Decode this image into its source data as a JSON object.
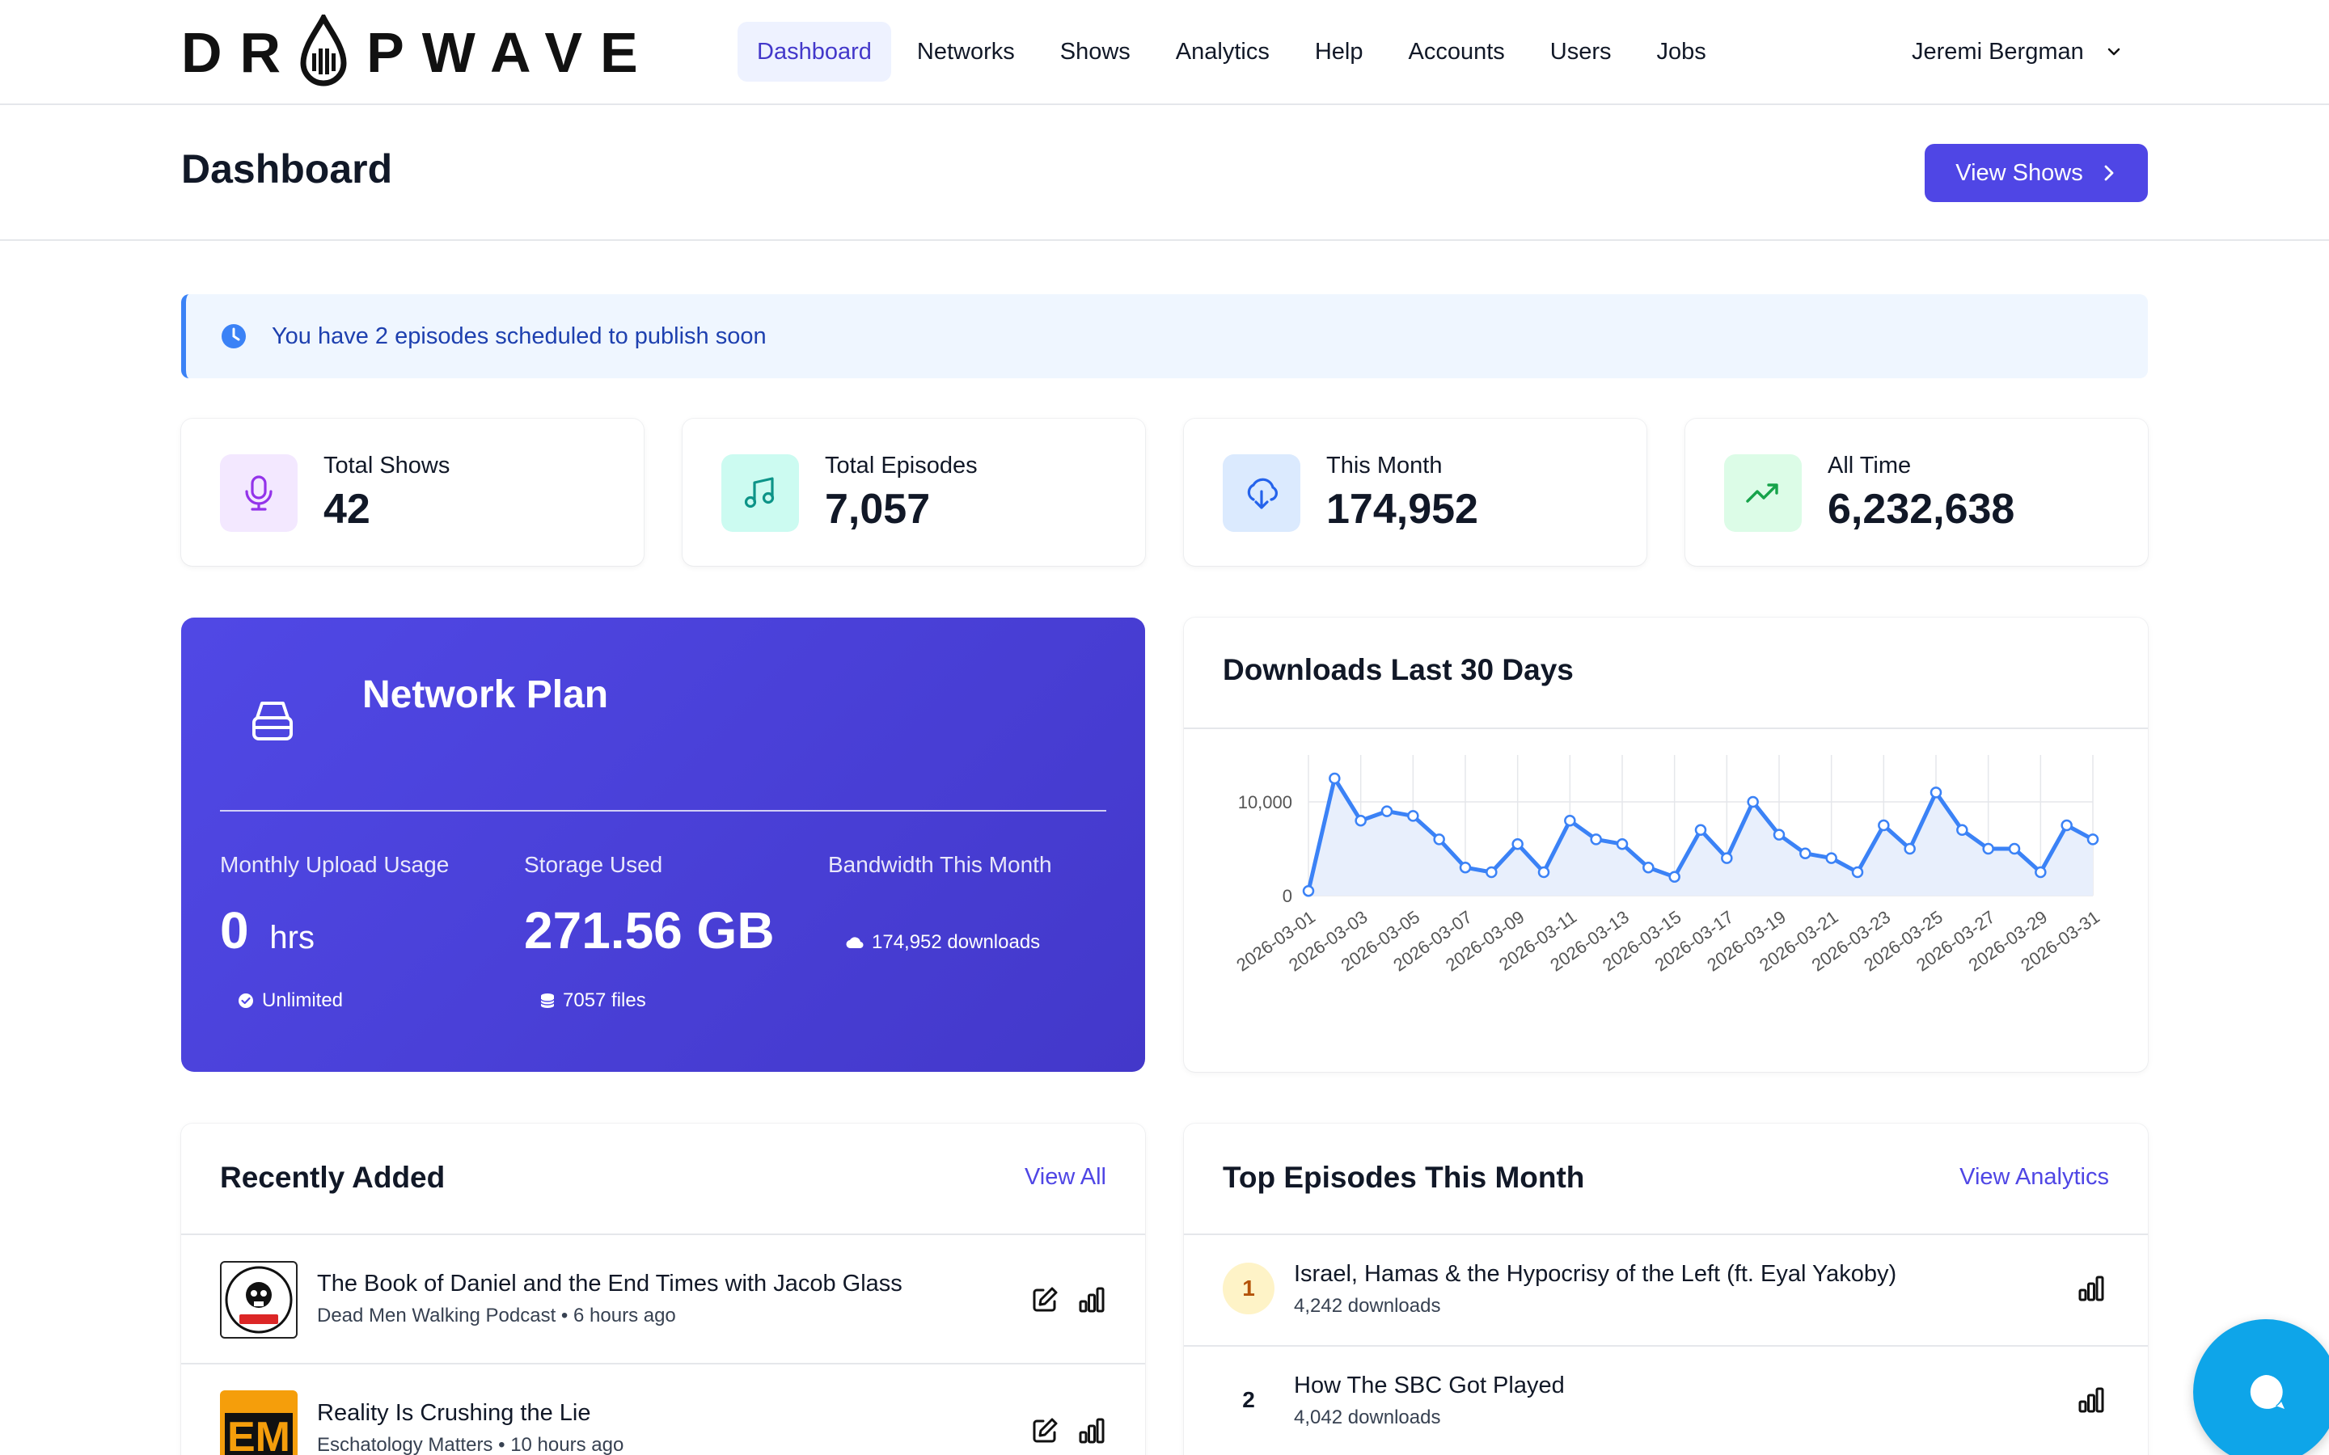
{
  "brand": {
    "logo_text": "DR",
    "logo_text2": "PWAVE"
  },
  "nav": {
    "items": [
      {
        "label": "Dashboard",
        "active": true
      },
      {
        "label": "Networks"
      },
      {
        "label": "Shows"
      },
      {
        "label": "Analytics"
      },
      {
        "label": "Help"
      },
      {
        "label": "Accounts"
      },
      {
        "label": "Users"
      },
      {
        "label": "Jobs"
      }
    ],
    "user_name": "Jeremi Bergman"
  },
  "header": {
    "title": "Dashboard",
    "view_shows_label": "View Shows"
  },
  "alert": {
    "text": "You have 2 episodes scheduled to publish soon"
  },
  "stats": [
    {
      "label": "Total Shows",
      "value": "42",
      "icon": "microphone-icon",
      "bg": "#f3e8ff",
      "fg": "#9333ea"
    },
    {
      "label": "Total Episodes",
      "value": "7,057",
      "icon": "music-note-icon",
      "bg": "#ccfbf1",
      "fg": "#0d9488"
    },
    {
      "label": "This Month",
      "value": "174,952",
      "icon": "cloud-download-icon",
      "bg": "#dbeafe",
      "fg": "#2563eb"
    },
    {
      "label": "All Time",
      "value": "6,232,638",
      "icon": "trending-up-icon",
      "bg": "#dcfce7",
      "fg": "#16a34a"
    }
  ],
  "plan": {
    "title": "Network Plan",
    "upload_label": "Monthly Upload Usage",
    "upload_value": "0",
    "upload_unit": "hrs",
    "upload_note": "Unlimited",
    "storage_label": "Storage Used",
    "storage_value": "271.56 GB",
    "storage_note": "7057 files",
    "bandwidth_label": "Bandwidth This Month",
    "bandwidth_note": "174,952 downloads"
  },
  "downloads_card": {
    "title": "Downloads Last 30 Days"
  },
  "chart_data": {
    "type": "area",
    "title": "Downloads Last 30 Days",
    "x": [
      "2026-03-01",
      "2026-03-02",
      "2026-03-03",
      "2026-03-04",
      "2026-03-05",
      "2026-03-06",
      "2026-03-07",
      "2026-03-08",
      "2026-03-09",
      "2026-03-10",
      "2026-03-11",
      "2026-03-12",
      "2026-03-13",
      "2026-03-14",
      "2026-03-15",
      "2026-03-16",
      "2026-03-17",
      "2026-03-18",
      "2026-03-19",
      "2026-03-20",
      "2026-03-21",
      "2026-03-22",
      "2026-03-23",
      "2026-03-24",
      "2026-03-25",
      "2026-03-26",
      "2026-03-27",
      "2026-03-28",
      "2026-03-29",
      "2026-03-30",
      "2026-03-31"
    ],
    "x_tick_labels": [
      "2026-03-01",
      "2026-03-03",
      "2026-03-05",
      "2026-03-07",
      "2026-03-09",
      "2026-03-11",
      "2026-03-13",
      "2026-03-15",
      "2026-03-17",
      "2026-03-19",
      "2026-03-21",
      "2026-03-23",
      "2026-03-25",
      "2026-03-27",
      "2026-03-29",
      "2026-03-31"
    ],
    "values": [
      500,
      12500,
      8000,
      9000,
      8500,
      6000,
      3000,
      2500,
      5500,
      2500,
      8000,
      6000,
      5500,
      3000,
      2000,
      7000,
      4000,
      10000,
      6500,
      4500,
      4000,
      2500,
      7500,
      5000,
      11000,
      7000,
      5000,
      5000,
      2500,
      7500,
      6000
    ],
    "y_ticks": [
      0,
      10000
    ],
    "y_tick_labels": [
      "0",
      "10,000"
    ],
    "ylim": [
      0,
      15000
    ],
    "grid": true,
    "line_color": "#3b82f6",
    "fill_color": "#e8effc"
  },
  "recent": {
    "title": "Recently Added",
    "link": "View All",
    "items": [
      {
        "title": "The Book of Daniel and the End Times with Jacob Glass",
        "show": "Dead Men Walking Podcast",
        "time": "6 hours ago",
        "thumb_text": "DEAD MEN WALKING"
      },
      {
        "title": "Reality Is Crushing the Lie",
        "show": "Eschatology Matters",
        "time": "10 hours ago",
        "thumb_text": "EM"
      }
    ]
  },
  "top": {
    "title": "Top Episodes This Month",
    "link": "View Analytics",
    "items": [
      {
        "rank": "1",
        "title": "Israel, Hamas & the Hypocrisy of the Left (ft. Eyal Yakoby)",
        "downloads": "4,242 downloads"
      },
      {
        "rank": "2",
        "title": "How The SBC Got Played",
        "downloads": "4,042 downloads"
      }
    ]
  },
  "colors": {
    "accent": "#4f46e5",
    "chat": "#0ea5e9"
  }
}
